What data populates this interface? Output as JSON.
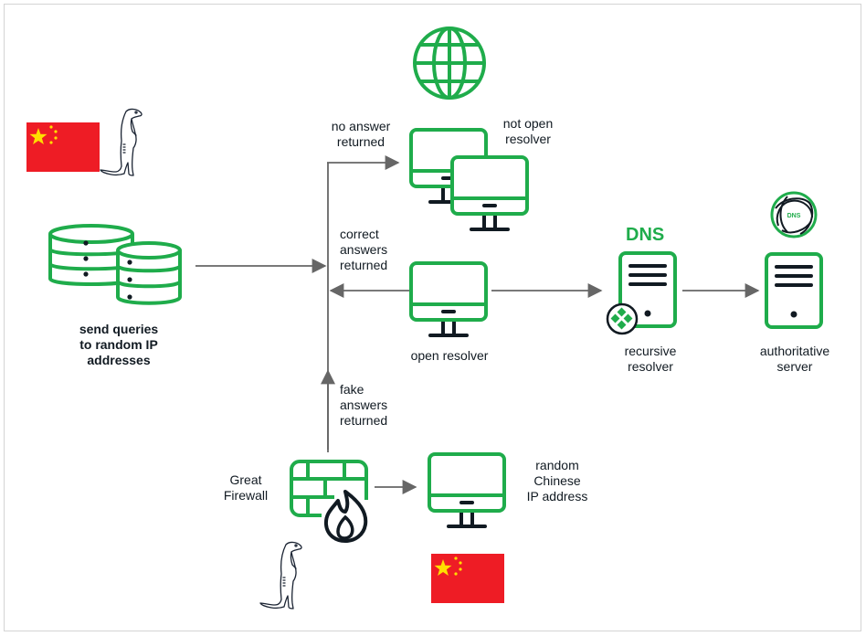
{
  "colors": {
    "green": "#1fac4b",
    "dark": "#111a22",
    "arrow": "#666666",
    "flag_red": "#ee1c25",
    "flag_star": "#ffde00",
    "frame": "#d4d4d4"
  },
  "nodes": {
    "scanner": {
      "label": "send queries\nto random IP\naddresses",
      "icon": "database-icon"
    },
    "globe": {
      "icon": "globe-icon"
    },
    "not_open_resolver": {
      "label": "not open\nresolver",
      "icon": "monitor-icon"
    },
    "open_resolver": {
      "label": "open resolver",
      "icon": "monitor-icon"
    },
    "recursive_resolver": {
      "title": "DNS",
      "label": "recursive\nresolver",
      "icon": "server-icon",
      "badge": "diamond-badge-icon"
    },
    "authoritative_server": {
      "label": "authoritative\nserver",
      "icon": "server-icon",
      "badge_text": "DNS"
    },
    "great_firewall": {
      "label": "Great\nFirewall",
      "icon": "firewall-icon"
    },
    "random_chinese_ip": {
      "label": "random\nChinese\nIP address",
      "icon": "monitor-icon"
    }
  },
  "edges": {
    "no_answer": "no answer\nreturned",
    "correct_answers": "correct\nanswers\nreturned",
    "fake_answers": "fake\nanswers\nreturned"
  },
  "decorations": {
    "flag_top": "china-flag-icon",
    "flag_bottom": "china-flag-icon",
    "meerkat_top": "meerkat-icon",
    "meerkat_bottom": "meerkat-icon"
  }
}
